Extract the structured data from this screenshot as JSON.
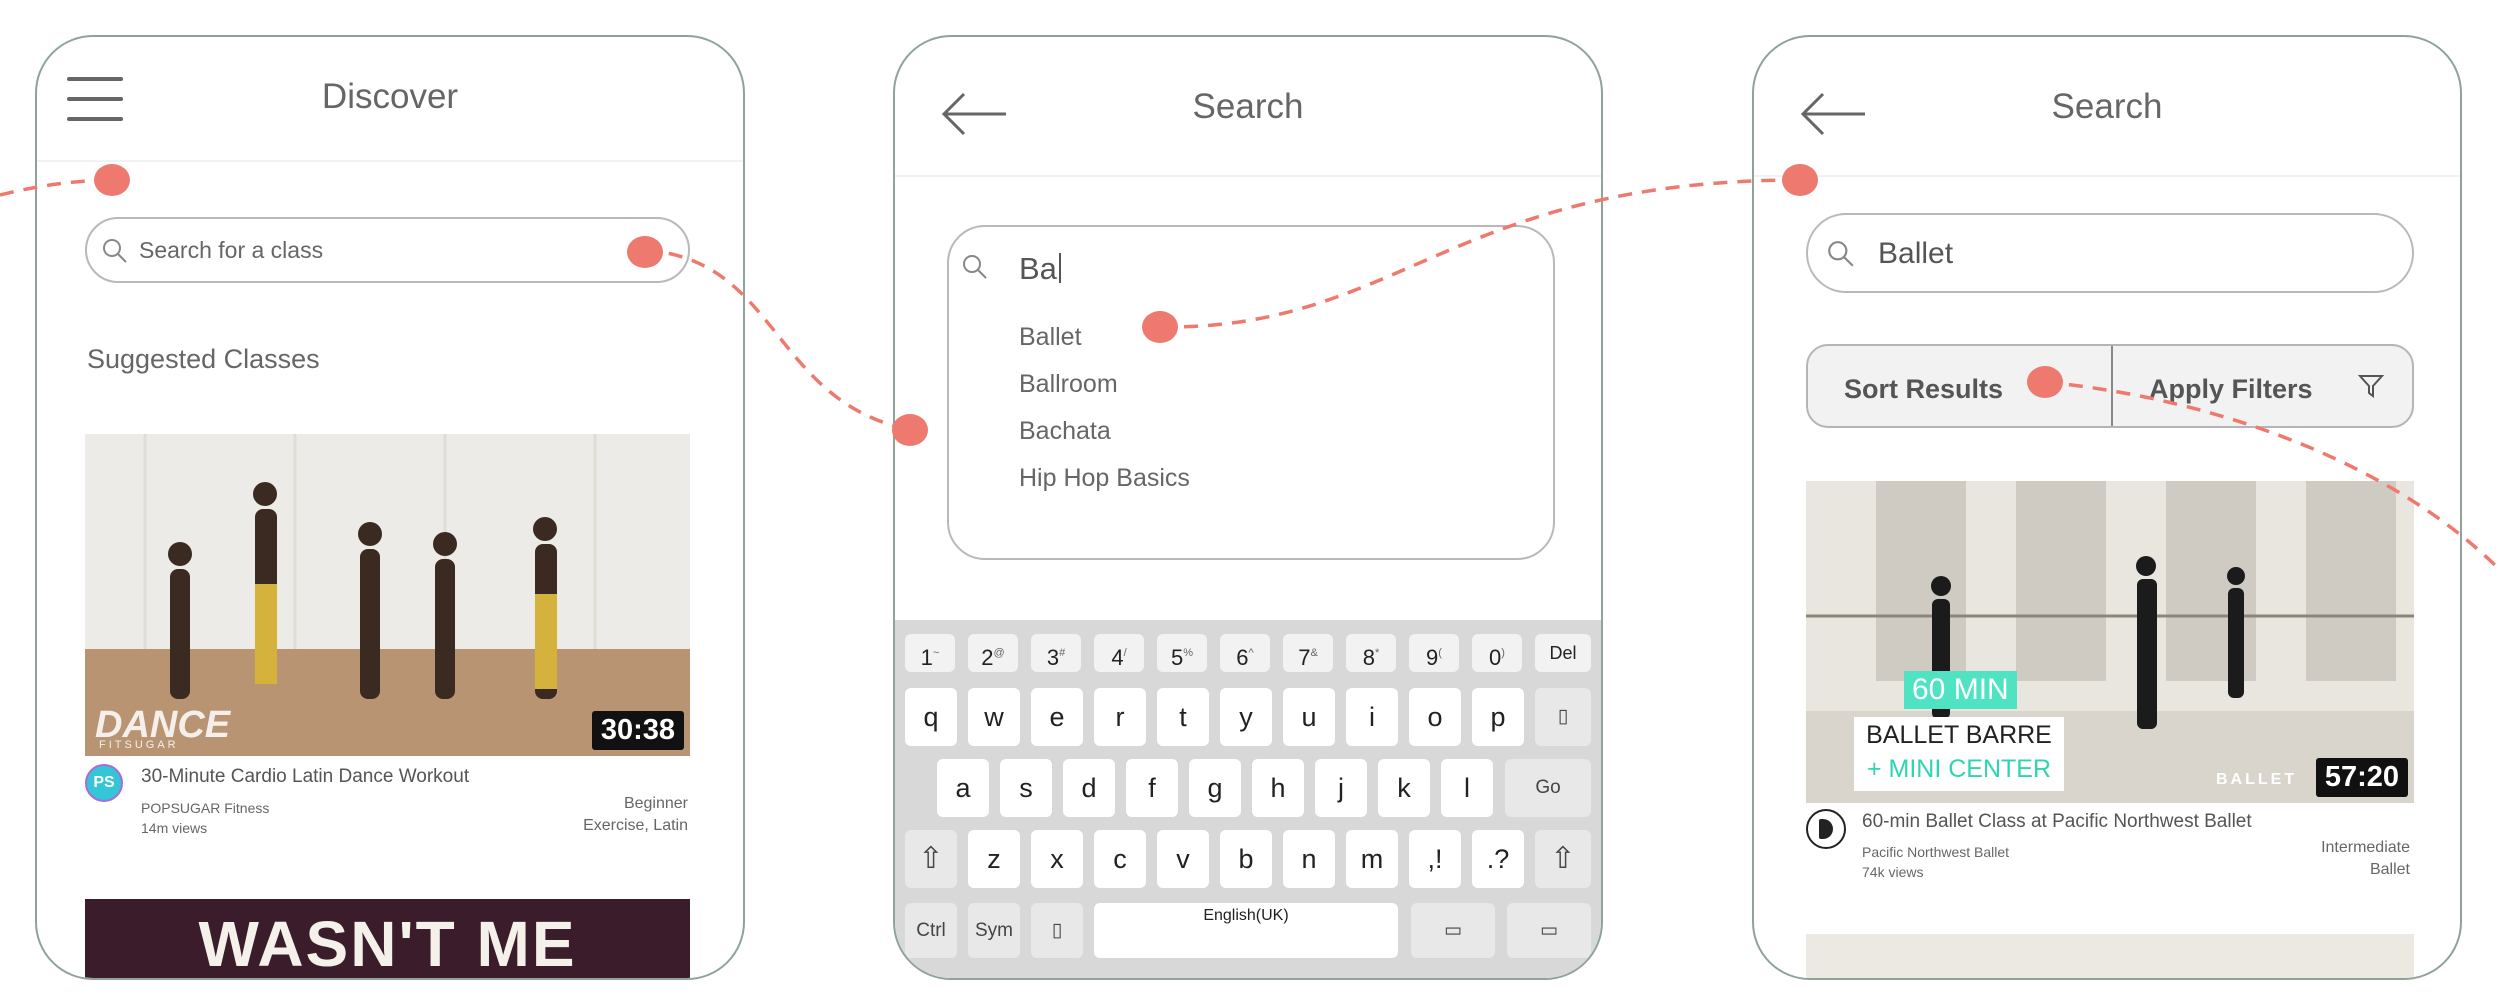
{
  "screens": {
    "discover": {
      "title": "Discover",
      "search_placeholder": "Search for a class",
      "section_title": "Suggested Classes",
      "videos": [
        {
          "title": "30-Minute Cardio Latin Dance Workout",
          "channel": "POPSUGAR Fitness",
          "views": "14m views",
          "level": "Beginner",
          "tags": "Exercise, Latin",
          "duration": "30:38",
          "thumb_overlay": "DANCE",
          "thumb_overlay_sub": "FITSUGAR",
          "avatar_text": "PS"
        },
        {
          "thumb_text": "WASN'T ME"
        }
      ]
    },
    "search_typing": {
      "title": "Search",
      "typed_text": "Ba",
      "suggestions": [
        "Ballet",
        "Ballroom",
        "Bachata",
        "Hip Hop Basics"
      ],
      "keyboard": {
        "num_row": [
          {
            "k": "1",
            "s": "~"
          },
          {
            "k": "2",
            "s": "@"
          },
          {
            "k": "3",
            "s": "#"
          },
          {
            "k": "4",
            "s": "/"
          },
          {
            "k": "5",
            "s": "%"
          },
          {
            "k": "6",
            "s": "^"
          },
          {
            "k": "7",
            "s": "&"
          },
          {
            "k": "8",
            "s": "*"
          },
          {
            "k": "9",
            "s": "("
          },
          {
            "k": "0",
            "s": ")"
          }
        ],
        "del_label": "Del",
        "row1": [
          "q",
          "w",
          "e",
          "r",
          "t",
          "y",
          "u",
          "i",
          "o",
          "p"
        ],
        "row2": [
          "a",
          "s",
          "d",
          "f",
          "g",
          "h",
          "j",
          "k",
          "l"
        ],
        "go_label": "Go",
        "row3": [
          "z",
          "x",
          "c",
          "v",
          "b",
          "n",
          "m"
        ],
        "punct1": ",!",
        "punct2": ".?",
        "ctrl_label": "Ctrl",
        "sym_label": "Sym",
        "space_label": "English(UK)"
      }
    },
    "search_results": {
      "title": "Search",
      "search_value": "Ballet",
      "sort_label": "Sort Results",
      "filter_label": "Apply Filters",
      "videos": [
        {
          "title": "60-min Ballet Class at Pacific Northwest Ballet",
          "channel": "Pacific Northwest Ballet",
          "views": "74k views",
          "level": "Intermediate",
          "tags": "Ballet",
          "duration": "57:20",
          "badge": "60 MIN",
          "caption1": "BALLET BARRE",
          "caption2": "+ MINI CENTER",
          "watermark": "BALLET"
        }
      ]
    }
  },
  "colors": {
    "accent": "#ee7a6f",
    "phone_border": "#8fa39a",
    "badge_teal": "#4fe3c4",
    "caption_teal": "#2fd4b3"
  }
}
